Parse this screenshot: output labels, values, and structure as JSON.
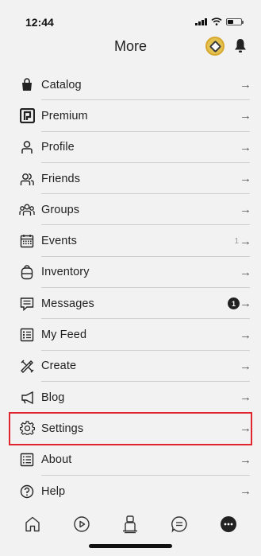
{
  "status": {
    "time": "12:44"
  },
  "header": {
    "title": "More"
  },
  "menu": [
    {
      "label": "Catalog",
      "icon": "shopping-bag-icon",
      "extra": "",
      "badge": ""
    },
    {
      "label": "Premium",
      "icon": "premium-icon",
      "extra": "",
      "badge": ""
    },
    {
      "label": "Profile",
      "icon": "person-icon",
      "extra": "",
      "badge": ""
    },
    {
      "label": "Friends",
      "icon": "friends-icon",
      "extra": "",
      "badge": ""
    },
    {
      "label": "Groups",
      "icon": "groups-icon",
      "extra": "",
      "badge": ""
    },
    {
      "label": "Events",
      "icon": "calendar-icon",
      "extra": "1",
      "badge": ""
    },
    {
      "label": "Inventory",
      "icon": "backpack-icon",
      "extra": "",
      "badge": ""
    },
    {
      "label": "Messages",
      "icon": "message-icon",
      "extra": "",
      "badge": "1"
    },
    {
      "label": "My Feed",
      "icon": "feed-icon",
      "extra": "",
      "badge": ""
    },
    {
      "label": "Create",
      "icon": "create-icon",
      "extra": "",
      "badge": ""
    },
    {
      "label": "Blog",
      "icon": "megaphone-icon",
      "extra": "",
      "badge": ""
    },
    {
      "label": "Settings",
      "icon": "gear-icon",
      "extra": "",
      "badge": ""
    },
    {
      "label": "About",
      "icon": "about-icon",
      "extra": "",
      "badge": ""
    },
    {
      "label": "Help",
      "icon": "help-icon",
      "extra": "",
      "badge": ""
    }
  ],
  "arrow": "→",
  "tabs": [
    "home-icon",
    "play-icon",
    "avatar-icon",
    "chat-icon",
    "more-icon"
  ],
  "colors": {
    "highlight": "#e0262c",
    "background": "#f2f2f2"
  }
}
